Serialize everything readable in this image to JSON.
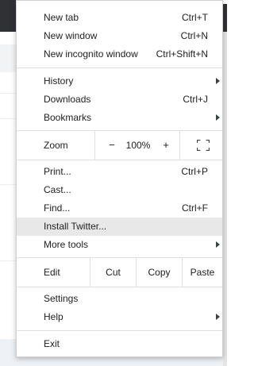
{
  "menu": {
    "section1": [
      {
        "label": "New tab",
        "shortcut": "Ctrl+T"
      },
      {
        "label": "New window",
        "shortcut": "Ctrl+N"
      },
      {
        "label": "New incognito window",
        "shortcut": "Ctrl+Shift+N"
      }
    ],
    "section2": [
      {
        "label": "History",
        "shortcut": ""
      },
      {
        "label": "Downloads",
        "shortcut": "Ctrl+J"
      },
      {
        "label": "Bookmarks",
        "shortcut": ""
      }
    ],
    "zoom": {
      "label": "Zoom",
      "minus": "−",
      "value": "100%",
      "plus": "+"
    },
    "section4": [
      {
        "label": "Print...",
        "shortcut": "Ctrl+P"
      },
      {
        "label": "Cast...",
        "shortcut": ""
      },
      {
        "label": "Find...",
        "shortcut": "Ctrl+F"
      },
      {
        "label": "Install Twitter...",
        "shortcut": ""
      },
      {
        "label": "More tools",
        "shortcut": ""
      }
    ],
    "edit": {
      "label": "Edit",
      "cut": "Cut",
      "copy": "Copy",
      "paste": "Paste"
    },
    "section6": [
      {
        "label": "Settings"
      },
      {
        "label": "Help"
      }
    ],
    "exit": {
      "label": "Exit"
    },
    "highlighted_item": "Install Twitter...",
    "colors": {
      "highlight": "#e8e8e8",
      "text": "#202124",
      "separator": "#e0e0e0",
      "background_topbar": "#303134"
    }
  }
}
